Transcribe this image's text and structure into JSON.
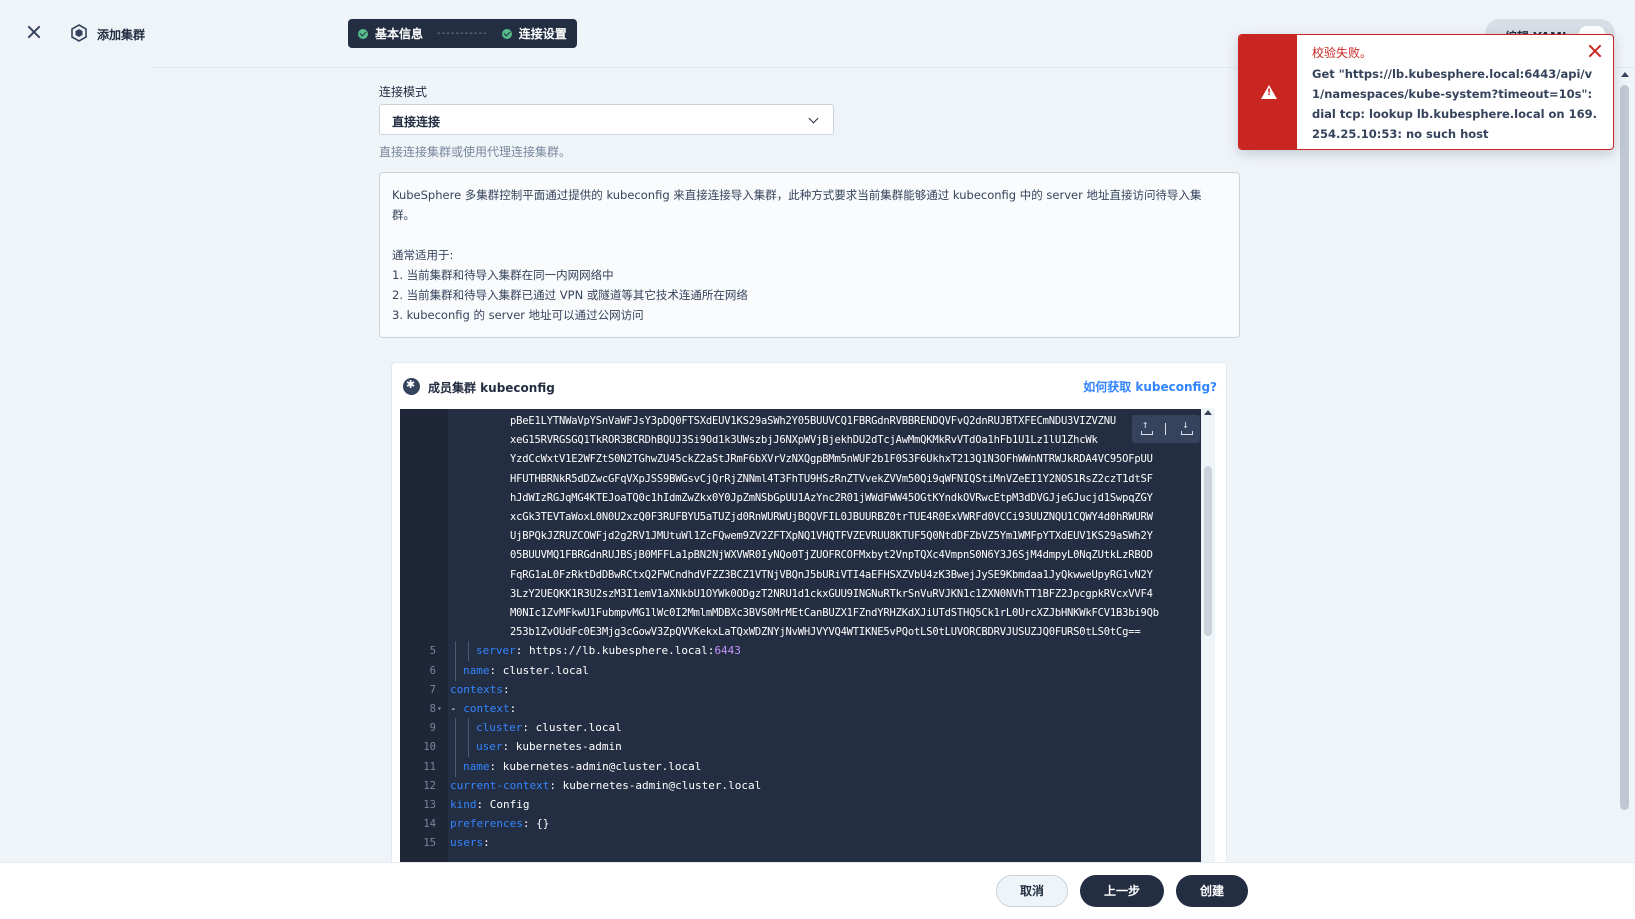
{
  "header": {
    "title": "添加集群",
    "steps": [
      "基本信息",
      "连接设置"
    ],
    "step_separator": "-----------",
    "yaml_toggle_label": "编辑 YAML"
  },
  "form": {
    "mode_label": "连接模式",
    "mode_value": "直接连接",
    "mode_desc": "直接连接集群或使用代理连接集群。"
  },
  "info": {
    "line1": "KubeSphere 多集群控制平面通过提供的 kubeconfig 来直接连接导入集群，此种方式要求当前集群能够通过 kubeconfig 中的 server 地址直接访问待导入集",
    "line2": "群。",
    "usage_title": "通常适用于:",
    "items": [
      "1. 当前集群和待导入集群在同一内网网络中",
      "2. 当前集群和待导入集群已通过 VPN 或隧道等其它技术连通所在网络",
      "3. kubeconfig 的 server 地址可以通过公网访问"
    ]
  },
  "kubeconfig": {
    "title": "成员集群 kubeconfig",
    "help_link": "如何获取 kubeconfig?",
    "wrapped_lines": [
      "pBeE1LYTNWaVpYSnVaWFJsY3pDQ0FTSXdEUV1KS29aSWh2Y05BUUVCQ1FBRGdnRVBBRENDQVFvQ2dnRUJBTXFECmNDU3VIZVZNU",
      "xeG15RVRGSGQ1TkROR3BCRDhBQUJ3Si9Od1k3UWszbjJ6NXpWVjBjekhDU2dTcjAwMmQKMkRvVTdOa1hFb1U1Lz1lU1ZhcWk",
      "YzdCcWxtV1E2WFZtS0N2TGhwZU45ckZ2aStJRmF6bXVrVzNXQgpBMm5nWUF2b1F0S3F6UkhxT213Q1N3OFhWWnNTRWJkRDA4VC95OFpUU",
      "HFUTHBRNkR5dDZwcGFqVXpJSS9BWGsvCjQrRjZNNml4T3FhTU9HSzRnZTVvekZVVm50Qi9qWFNIQStiMnVZeEI1Y2NOS1RsZ2czT1dtSF",
      "hJdWIzRGJqMG4KTEJoaTQ0c1hIdmZwZkx0Y0JpZmNSbGpUU1AzYnc2R01jWWdFWW45OGtKYndkOVRwcEtpM3dDVGJjeGJucjd1SwpqZGY",
      "xcGk3TEVTaWoxL0N0U2xzQ0F3RUFBYU5aTUZjd0RnWURWUjBQQVFIL0JBUURBZ0trTUE4R0ExVWRFd0VCCi93UUZNQU1CQWY4d0hRWURW",
      "UjBPQkJZRUZCOWFjd2g2RV1JMUtuWl1ZcFQwem9ZV2ZFTXpNQ1VHQTFVZEVRUU8KTUF5Q0NtdDFZbVZ5Ym1WMFpYTXdEUV1KS29aSWh2Y",
      "05BUUVMQ1FBRGdnRUJBSjB0MFFLa1pBN2NjWXVWR0IyNQo0TjZUOFRCOFMxbyt2VnpTQXc4VmpnS0N6Y3J6SjM4dmpyL0NqZUtkLzRBOD",
      "FqRG1aL0FzRktDdDBwRCtxQ2FWCndhdVFZZ3BCZ1VTNjVBQnJ5bURiVTI4aEFHSXZVbU4zK3BwejJySE9Kbmdaa1JyQkwweUpyRG1vN2Y",
      "3LzY2UEQKK1R3U2szM3I1emV1aXNkbU1OYWk0ODgzT2NRU1d1ckxGUU9INGNuRTkrSnVuRVJKN1c1ZXN0NVhTT1BFZ2JpcgpkRVcxVVF4",
      "M0NIc1ZvMFkwU1FubmpvMG1lWc0I2MmlmMDBXc3BVS0MrMEtCanBUZX1FZndYRHZKdXJiUTdSTHQ5Ck1rL0UrcXZJbHNKWkFCV1B3bi9Qb",
      "253b1ZvOUdFc0E3Mjg3cGowV3ZpQVVKekxLaTQxWDZNYjNvWHJVYVQ4WTIKNE5vPQotLS0tLUVORCBDRVJUSUZJQ0FURS0tLS0tCg=="
    ],
    "lines": [
      {
        "n": "5",
        "indent": 2,
        "key": "server",
        "value": "https://lb.kubesphere.local:",
        "port": "6443"
      },
      {
        "n": "6",
        "indent": 1,
        "key": "name",
        "value": "cluster.local"
      },
      {
        "n": "7",
        "indent": 0,
        "key": "contexts",
        "value": ""
      },
      {
        "n": "8",
        "indent": 0,
        "dash": true,
        "key": "context",
        "value": "",
        "fold": true
      },
      {
        "n": "9",
        "indent": 2,
        "key": "cluster",
        "value": "cluster.local"
      },
      {
        "n": "10",
        "indent": 2,
        "key": "user",
        "value": "kubernetes-admin"
      },
      {
        "n": "11",
        "indent": 1,
        "key": "name",
        "value": "kubernetes-admin@cluster.local"
      },
      {
        "n": "12",
        "indent": 0,
        "key": "current-context",
        "value": "kubernetes-admin@cluster.local"
      },
      {
        "n": "13",
        "indent": 0,
        "key": "kind",
        "value": "Config"
      },
      {
        "n": "14",
        "indent": 0,
        "key": "preferences",
        "value": "{}"
      },
      {
        "n": "15",
        "indent": 0,
        "key": "users",
        "value": ""
      }
    ]
  },
  "footer": {
    "cancel": "取消",
    "prev": "上一步",
    "create": "创建"
  },
  "notification": {
    "title": "校验失败。",
    "message": "Get \"https://lb.kubesphere.local:6443/api/v1/namespaces/kube-system?timeout=10s\": dial tcp: lookup lb.kubesphere.local on 169.254.25.10:53: no such host"
  },
  "colors": {
    "dark": "#242e42",
    "error": "#ca2621",
    "link": "#3385ff",
    "success": "#55bc8a"
  }
}
